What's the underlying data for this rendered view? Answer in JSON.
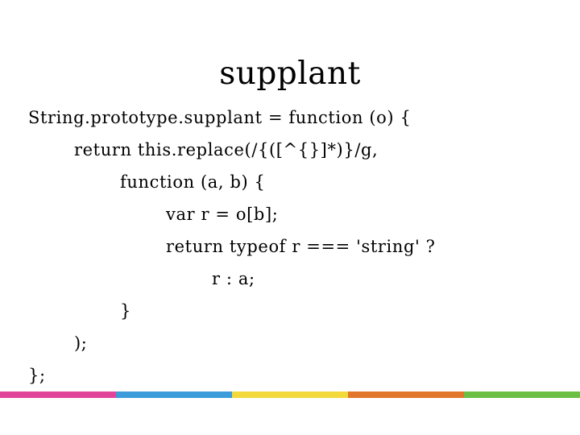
{
  "slide": {
    "title": "supplant",
    "background_color": "#ffffff",
    "text_color": "#000000",
    "code_lines": [
      {
        "indent": 0,
        "text": "String.prototype.supplant = function (o) {"
      },
      {
        "indent": 1,
        "text": "return this.replace(/{([^{}]*)}/g,"
      },
      {
        "indent": 2,
        "text": "function (a, b) {"
      },
      {
        "indent": 3,
        "text": "var r = o[b];"
      },
      {
        "indent": 3,
        "text": "return typeof r === 'string' ?"
      },
      {
        "indent": 4,
        "text": "r : a;"
      },
      {
        "indent": 2,
        "text": "}"
      },
      {
        "indent": 1,
        "text": ");"
      },
      {
        "indent": 0,
        "text": "};"
      }
    ],
    "accent_bar": {
      "segments": [
        {
          "name": "magenta",
          "color": "#E0459A"
        },
        {
          "name": "blue",
          "color": "#3C9BD9"
        },
        {
          "name": "yellow",
          "color": "#F2D93C"
        },
        {
          "name": "orange",
          "color": "#E2762A"
        },
        {
          "name": "green",
          "color": "#6CBF45"
        }
      ]
    }
  }
}
